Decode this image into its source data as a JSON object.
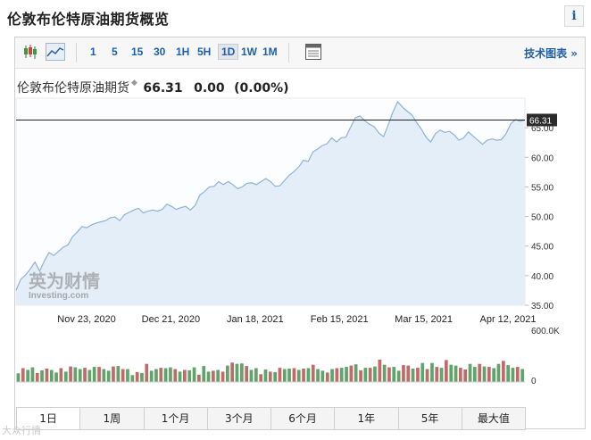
{
  "page_title": "伦敦布伦特原油期货概览",
  "info_label": "i",
  "toolbar": {
    "ranges": [
      "1",
      "5",
      "15",
      "30",
      "1H",
      "5H",
      "1D",
      "1W",
      "1M"
    ],
    "active_range": "1D",
    "technical_label": "技术图表 »"
  },
  "quote": {
    "name": "伦敦布伦特原油期货",
    "price": "66.31",
    "change": "0.00",
    "change_pct": "(0.00%)"
  },
  "watermark": {
    "brand": "英为财情",
    "sub": "Investing.com",
    "bottom": "大众行情"
  },
  "periods": [
    "1日",
    "1周",
    "1个月",
    "3个月",
    "6个月",
    "1年",
    "5年",
    "最大值"
  ],
  "active_period": "1日",
  "colors": {
    "area_fill": "#e4eef8",
    "line": "#8fb2d6",
    "up": "#5fa56a",
    "down": "#c26a6a",
    "accent": "#1f5fa8"
  },
  "chart_data": {
    "type": "area",
    "price_axis": {
      "ticks": [
        "65.00",
        "60.00",
        "55.00",
        "50.00",
        "45.00",
        "40.00",
        "35.00"
      ],
      "ylim": [
        35,
        70
      ],
      "current_label": "66.31"
    },
    "x_tick_labels": [
      "Nov 23, 2020",
      "Dec 21, 2020",
      "Jan 18, 2021",
      "Feb 15, 2021",
      "Mar 15, 2021",
      "Apr 12, 2021"
    ],
    "volume_axis": {
      "ticks": [
        "600.0K",
        "0"
      ],
      "ylim": [
        0,
        600000
      ]
    },
    "price_series": [
      37.5,
      39.4,
      40.1,
      41.1,
      42.3,
      40.8,
      42.5,
      43.9,
      43.4,
      44.1,
      44.8,
      45.2,
      46.6,
      47.4,
      48.3,
      48.1,
      48.6,
      48.9,
      49.1,
      49.3,
      49.8,
      49.9,
      49.3,
      50.3,
      50.7,
      51.1,
      51.4,
      50.6,
      50.9,
      51.1,
      50.9,
      51.2,
      52.1,
      51.7,
      51.2,
      51.5,
      51.7,
      51.1,
      51.9,
      53.6,
      54.2,
      55.0,
      55.1,
      55.9,
      55.4,
      55.9,
      55.4,
      54.7,
      55.0,
      55.6,
      55.7,
      55.4,
      55.9,
      56.4,
      55.9,
      55.1,
      55.2,
      56.1,
      57.0,
      57.6,
      58.4,
      59.5,
      59.3,
      60.9,
      61.4,
      62.0,
      62.3,
      63.3,
      62.6,
      63.3,
      63.4,
      65.1,
      66.7,
      67.0,
      66.2,
      65.6,
      65.2,
      64.1,
      63.5,
      65.5,
      67.7,
      69.4,
      68.5,
      67.8,
      67.2,
      65.9,
      64.8,
      63.4,
      62.6,
      64.0,
      64.6,
      64.2,
      64.4,
      63.8,
      62.9,
      63.3,
      64.3,
      63.6,
      62.9,
      62.2,
      62.9,
      63.1,
      62.9,
      63.0,
      64.0,
      65.7,
      66.4,
      66.1,
      66.3
    ],
    "volume_series": [
      100,
      160,
      140,
      170,
      105,
      135,
      155,
      140,
      110,
      160,
      120,
      180,
      170,
      150,
      165,
      140,
      175,
      175,
      150,
      130,
      180,
      185,
      150,
      150,
      80,
      115,
      105,
      210,
      130,
      150,
      165,
      160,
      170,
      150,
      120,
      140,
      135,
      170,
      85,
      185,
      120,
      130,
      140,
      120,
      190,
      225,
      210,
      215,
      185,
      140,
      160,
      90,
      145,
      120,
      115,
      165,
      150,
      155,
      160,
      140,
      155,
      160,
      200,
      150,
      130,
      110,
      150,
      160,
      165,
      175,
      190,
      205,
      135,
      165,
      165,
      180,
      260,
      200,
      170,
      175,
      130,
      195,
      190,
      155,
      165,
      220,
      150,
      220,
      175,
      165,
      255,
      200,
      190,
      165,
      145,
      210,
      175,
      210,
      180,
      175,
      160,
      210,
      245,
      195,
      165,
      175,
      150
    ],
    "volume_up": [
      1,
      0,
      1,
      1,
      0,
      1,
      0,
      1,
      1,
      0,
      1,
      0,
      1,
      1,
      0,
      1,
      1,
      0,
      1,
      1,
      0,
      1,
      0,
      1,
      1,
      0,
      1,
      0,
      1,
      1,
      0,
      1,
      1,
      0,
      1,
      0,
      1,
      1,
      0,
      1,
      1,
      0,
      1,
      0,
      1,
      0,
      1,
      1,
      0,
      1,
      1,
      0,
      1,
      0,
      1,
      0,
      1,
      1,
      0,
      1,
      0,
      1,
      0,
      1,
      1,
      0,
      1,
      0,
      1,
      1,
      0,
      1,
      0,
      1,
      0,
      1,
      0,
      1,
      0,
      1,
      1,
      0,
      0,
      1,
      0,
      1,
      0,
      1,
      0,
      1,
      0,
      1,
      1,
      0,
      0,
      1,
      1,
      0,
      1,
      0,
      1,
      1,
      0,
      1,
      1,
      0,
      1
    ]
  }
}
